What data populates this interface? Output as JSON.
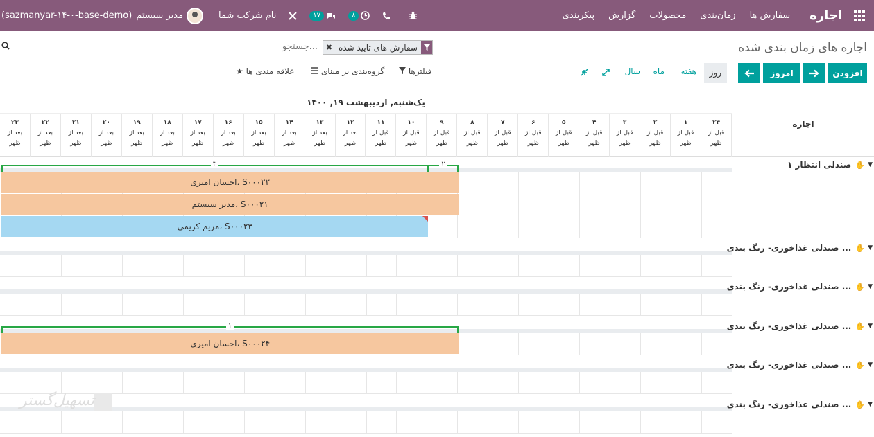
{
  "topbar": {
    "brand": "اجاره",
    "menu": [
      "سفارش ها",
      "زمان‌بندی",
      "محصولات",
      "گزارش",
      "پیکربندی"
    ],
    "company": "نام شرکت شما",
    "user": "مدیر سیستم",
    "database": "(sazmanyar-۱۴-۰-base-demo)",
    "messages_count": "۱۷",
    "activities_count": "۸"
  },
  "control": {
    "title": "اجاره های زمان بندی شده",
    "facet": "سفارش های تایید شده",
    "search_placeholder": "جستجو...",
    "add_label": "افزودن",
    "today_label": "امروز",
    "scales": {
      "day": "روز",
      "week": "هفته",
      "month": "ماه",
      "year": "سال"
    },
    "filters_label": "فیلترها",
    "groupby_label": "گروه‌بندی بر مبنای",
    "favorites_label": "علاقه مندی ها"
  },
  "gantt": {
    "row_header": "اجاره",
    "date_header": "یک‌شنبه, اردیبهشت ۱۹, ۱۴۰۰",
    "hours": [
      {
        "n": "۲۴",
        "p": "قبل از ظهر"
      },
      {
        "n": "۱",
        "p": "قبل از ظهر"
      },
      {
        "n": "۲",
        "p": "قبل از ظهر"
      },
      {
        "n": "۳",
        "p": "قبل از ظهر"
      },
      {
        "n": "۴",
        "p": "قبل از ظهر"
      },
      {
        "n": "۵",
        "p": "قبل از ظهر"
      },
      {
        "n": "۶",
        "p": "قبل از ظهر"
      },
      {
        "n": "۷",
        "p": "قبل از ظهر"
      },
      {
        "n": "۸",
        "p": "قبل از ظهر"
      },
      {
        "n": "۹",
        "p": "قبل از ظهر"
      },
      {
        "n": "۱۰",
        "p": "قبل از ظهر"
      },
      {
        "n": "۱۱",
        "p": "قبل از ظهر"
      },
      {
        "n": "۱۲",
        "p": "بعد از ظهر"
      },
      {
        "n": "۱۳",
        "p": "بعد از ظهر"
      },
      {
        "n": "۱۴",
        "p": "بعد از ظهر"
      },
      {
        "n": "۱۵",
        "p": "بعد از ظهر"
      },
      {
        "n": "۱۶",
        "p": "بعد از ظهر"
      },
      {
        "n": "۱۷",
        "p": "بعد از ظهر"
      },
      {
        "n": "۱۸",
        "p": "بعد از ظهر"
      },
      {
        "n": "۱۹",
        "p": "بعد از ظهر"
      },
      {
        "n": "۲۰",
        "p": "بعد از ظهر"
      },
      {
        "n": "۲۱",
        "p": "بعد از ظهر"
      },
      {
        "n": "۲۲",
        "p": "بعد از ظهر"
      },
      {
        "n": "۲۳",
        "p": "بعد از ظهر"
      }
    ],
    "groups": [
      {
        "title": "صندلی انتظار ۱",
        "counts": [
          "۲",
          "۳"
        ],
        "pills": [
          {
            "label": "احسان امیری، S۰۰۰۲۲"
          },
          {
            "label": "مدیر سیستم، S۰۰۰۲۱"
          },
          {
            "label": "مریم کریمی، S۰۰۰۲۳"
          }
        ]
      },
      {
        "title": "صندلی غذاخوری- رنگ بندی ...",
        "counts": [],
        "pills": []
      },
      {
        "title": "صندلی غذاخوری- رنگ بندی ...",
        "counts": [],
        "pills": []
      },
      {
        "title": "صندلی غذاخوری- رنگ بندی ...",
        "counts": [
          "۱"
        ],
        "pills": [
          {
            "label": "احسان امیری، S۰۰۰۲۴"
          }
        ]
      },
      {
        "title": "صندلی غذاخوری- رنگ بندی ...",
        "counts": [],
        "pills": []
      },
      {
        "title": "صندلی غذاخوری- رنگ بندی ...",
        "counts": [],
        "pills": []
      }
    ]
  },
  "watermark": "تسهیل‌گستر"
}
